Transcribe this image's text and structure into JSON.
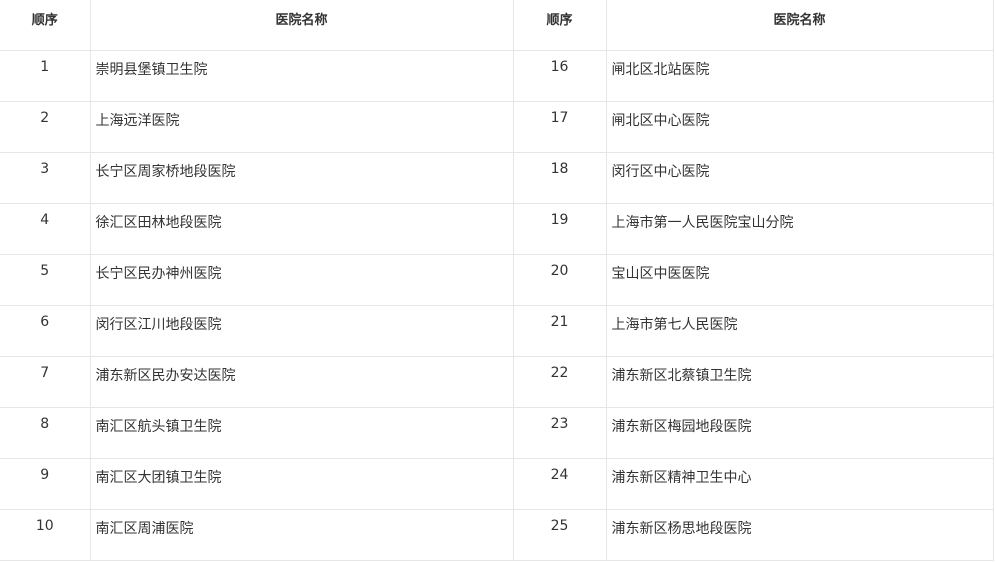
{
  "table": {
    "headers": [
      "顺序",
      "医院名称",
      "顺序",
      "医院名称"
    ],
    "rows": [
      {
        "no_left": "1",
        "name_left": "崇明县堡镇卫生院",
        "no_right": "16",
        "name_right": "闸北区北站医院"
      },
      {
        "no_left": "2",
        "name_left": "上海远洋医院",
        "no_right": "17",
        "name_right": "闸北区中心医院"
      },
      {
        "no_left": "3",
        "name_left": "长宁区周家桥地段医院",
        "no_right": "18",
        "name_right": "闵行区中心医院"
      },
      {
        "no_left": "4",
        "name_left": "徐汇区田林地段医院",
        "no_right": "19",
        "name_right": "上海市第一人民医院宝山分院"
      },
      {
        "no_left": "5",
        "name_left": "长宁区民办神州医院",
        "no_right": "20",
        "name_right": "宝山区中医医院"
      },
      {
        "no_left": "6",
        "name_left": "闵行区江川地段医院",
        "no_right": "21",
        "name_right": "上海市第七人民医院"
      },
      {
        "no_left": "7",
        "name_left": "浦东新区民办安达医院",
        "no_right": "22",
        "name_right": "浦东新区北蔡镇卫生院"
      },
      {
        "no_left": "8",
        "name_left": "南汇区航头镇卫生院",
        "no_right": "23",
        "name_right": "浦东新区梅园地段医院"
      },
      {
        "no_left": "9",
        "name_left": "南汇区大团镇卫生院",
        "no_right": "24",
        "name_right": "浦东新区精神卫生中心"
      },
      {
        "no_left": "10",
        "name_left": "南汇区周浦医院",
        "no_right": "25",
        "name_right": "浦东新区杨思地段医院"
      }
    ]
  }
}
